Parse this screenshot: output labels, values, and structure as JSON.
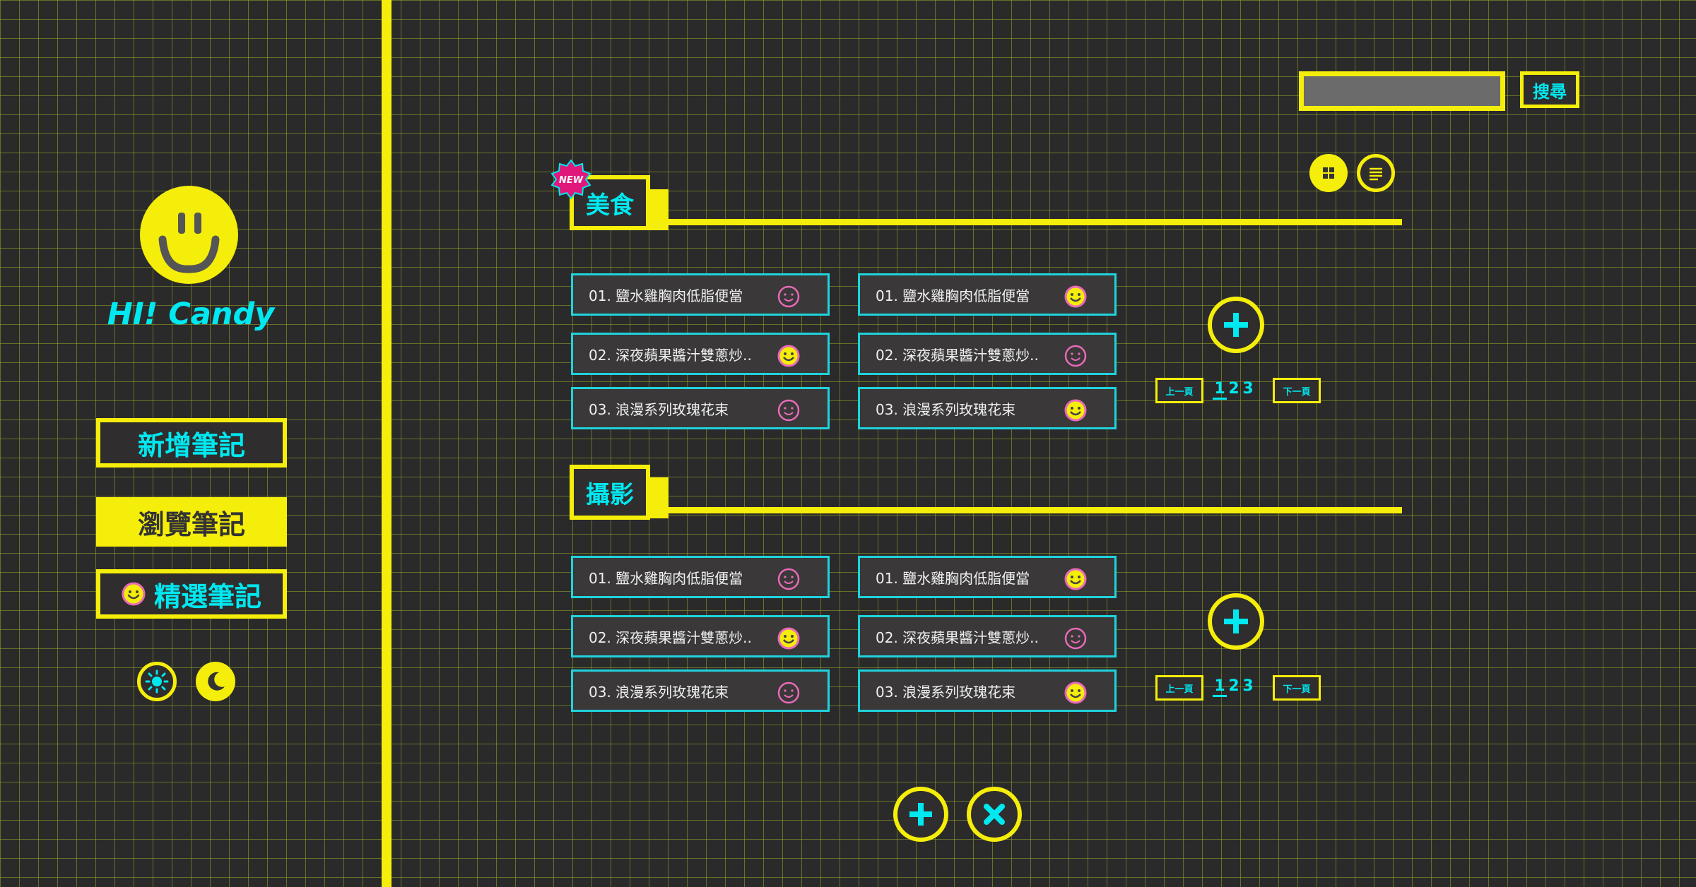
{
  "app": {
    "user_name": "HI! Candy"
  },
  "sidebar": {
    "buttons": [
      {
        "label": "新增筆記"
      },
      {
        "label": "瀏覽筆記"
      },
      {
        "label": "精選筆記"
      }
    ],
    "theme_toggle": {
      "light_icon": "sun-icon",
      "dark_icon": "moon-icon"
    }
  },
  "search": {
    "placeholder": "",
    "button_label": "搜尋"
  },
  "view_toggle": {
    "grid_icon": "grid-view-icon",
    "list_icon": "list-view-icon"
  },
  "colors": {
    "accent": "#f5ee0a",
    "highlight": "#00e8f0",
    "background": "#2b2a2a",
    "badge": "#e0187c",
    "smiley_outline": "#e86ab8"
  },
  "categories": [
    {
      "title": "美食",
      "badge": "NEW",
      "columns": [
        [
          {
            "label": "01. 鹽水雞胸肉低脂便當",
            "favorite": false
          },
          {
            "label": "02. 深夜蘋果醬汁雙蔥炒..",
            "favorite": true
          },
          {
            "label": "03. 浪漫系列玫瑰花束",
            "favorite": false
          }
        ],
        [
          {
            "label": "01. 鹽水雞胸肉低脂便當",
            "favorite": true
          },
          {
            "label": "02. 深夜蘋果醬汁雙蔥炒..",
            "favorite": false
          },
          {
            "label": "03. 浪漫系列玫瑰花束",
            "favorite": true
          }
        ]
      ],
      "pagination": {
        "prev": "上一頁",
        "next": "下一頁",
        "pages": [
          "1",
          "2",
          "3"
        ],
        "current": "1"
      }
    },
    {
      "title": "攝影",
      "badge": "",
      "columns": [
        [
          {
            "label": "01. 鹽水雞胸肉低脂便當",
            "favorite": false
          },
          {
            "label": "02. 深夜蘋果醬汁雙蔥炒..",
            "favorite": true
          },
          {
            "label": "03. 浪漫系列玫瑰花束",
            "favorite": false
          }
        ],
        [
          {
            "label": "01. 鹽水雞胸肉低脂便當",
            "favorite": true
          },
          {
            "label": "02. 深夜蘋果醬汁雙蔥炒..",
            "favorite": false
          },
          {
            "label": "03. 浪漫系列玫瑰花束",
            "favorite": true
          }
        ]
      ],
      "pagination": {
        "prev": "上一頁",
        "next": "下一頁",
        "pages": [
          "1",
          "2",
          "3"
        ],
        "current": "1"
      }
    }
  ],
  "footer_actions": {
    "add_icon": "plus-icon",
    "close_icon": "close-icon"
  }
}
